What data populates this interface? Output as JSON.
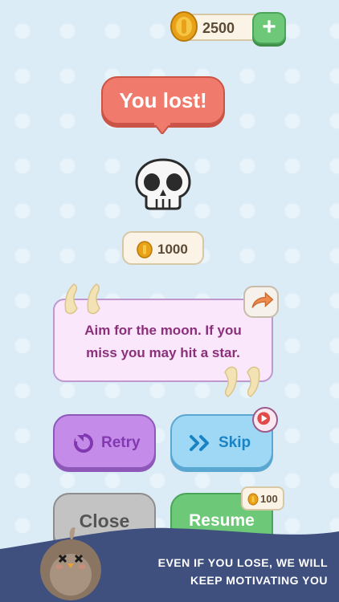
{
  "coins": {
    "balance": "2500",
    "add_icon": "plus-icon"
  },
  "result": {
    "title": "You lost!",
    "icon": "skull-icon"
  },
  "reward": {
    "amount": "1000"
  },
  "quote": {
    "line1": "Aim for the moon. If you",
    "line2": "miss you may hit a star."
  },
  "buttons": {
    "retry_label": "Retry",
    "skip_label": "Skip",
    "close_label": "Close",
    "resume_label": "Resume",
    "resume_cost": "100"
  },
  "banner": {
    "line1": "EVEN IF YOU LOSE, WE WILL",
    "line2": "KEEP MOTIVATING YOU"
  },
  "colors": {
    "background": "#dcecf7",
    "lost_red": "#f07b6c",
    "retry_purple": "#c48ce8",
    "skip_blue": "#9fd8f5",
    "resume_green": "#6dc978",
    "close_grey": "#c3c3c3",
    "banner_navy": "#3f4f7e",
    "quote_text": "#8b2f7b"
  }
}
